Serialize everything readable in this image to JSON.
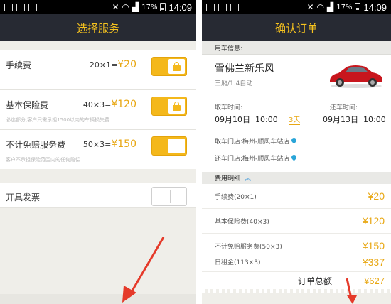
{
  "statusbar": {
    "time": "14:09",
    "battery": "17%"
  },
  "left": {
    "title": "选择服务",
    "services": [
      {
        "name": "手续费",
        "formula": "20×1=",
        "amount": "¥20",
        "note": "",
        "toggle": "on",
        "locked": true
      },
      {
        "name": "基本保险费",
        "formula": "40×3=",
        "amount": "¥120",
        "note": "必选部分,客户只需承担1500以内的车辆损失费",
        "toggle": "on",
        "locked": true
      },
      {
        "name": "不计免赔服务费",
        "formula": "50×3=",
        "amount": "¥150",
        "note": "客户不承担保险范围内的任何赔偿",
        "toggle": "on",
        "locked": false
      }
    ],
    "invoice": {
      "name": "开具发票",
      "toggle": "off"
    }
  },
  "right": {
    "title": "确认订单",
    "section_car_info": "用车信息:",
    "car": {
      "name": "雪佛兰新乐风",
      "spec": "三厢/1.4自动"
    },
    "pickup": {
      "label": "取车时间:",
      "date": "09月10日",
      "time": "10:00"
    },
    "days": "3天",
    "return": {
      "label": "还车时间:",
      "date": "09月13日",
      "time": "10:00"
    },
    "pickup_store": "取车门店:梅州-顺风车站店",
    "return_store": "还车门店:梅州-顺风车站店",
    "fee_header": "费用明细",
    "fees": [
      {
        "label": "手续费(20×1)",
        "amount": "¥20"
      },
      {
        "label": "基本保险费(40×3)",
        "amount": "¥120"
      },
      {
        "label": "不计免赔服务费(50×3)",
        "amount": "¥150"
      },
      {
        "label": "日租金(113×3)",
        "amount": "¥337"
      }
    ],
    "total": {
      "label": "订单总额",
      "amount": "¥627"
    }
  },
  "colors": {
    "accent": "#f4b81b",
    "title_bar": "#272a33",
    "arrow": "#e53a2a",
    "pin": "#2aa5d8"
  }
}
